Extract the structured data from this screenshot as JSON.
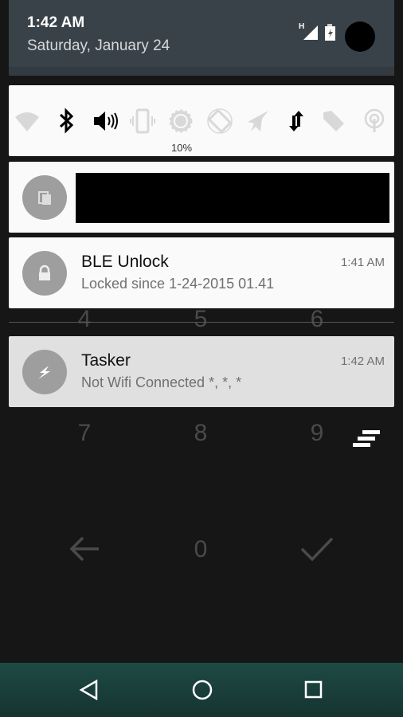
{
  "header": {
    "time": "1:42 AM",
    "date": "Saturday, January 24",
    "network_type": "H"
  },
  "quick_settings": {
    "items": [
      {
        "icon": "wifi-icon",
        "active": false
      },
      {
        "icon": "bluetooth-icon",
        "active": true
      },
      {
        "icon": "volume-icon",
        "active": true
      },
      {
        "icon": "vibrate-icon",
        "active": false
      },
      {
        "icon": "brightness-icon",
        "active": false
      },
      {
        "icon": "auto-rotate-icon",
        "active": false
      },
      {
        "icon": "airplane-icon",
        "active": false
      },
      {
        "icon": "mobile-data-icon",
        "active": true
      },
      {
        "icon": "nfc-tag-icon",
        "active": false
      },
      {
        "icon": "hotspot-icon",
        "active": false
      }
    ],
    "brightness_label": "10%"
  },
  "notifications": [
    {
      "app_icon": "clipboard-icon",
      "redacted": true
    },
    {
      "app_icon": "lock-icon",
      "title": "BLE Unlock",
      "text": "Locked since 1-24-2015 01.41",
      "time": "1:41 AM"
    },
    {
      "app_icon": "lightning-icon",
      "title": "Tasker",
      "text": "Not Wifi Connected *, *, *",
      "time": "1:42 AM"
    }
  ],
  "keypad": {
    "k4": "4",
    "k5": "5",
    "k6": "6",
    "k7": "7",
    "k8": "8",
    "k9": "9",
    "k0": "0"
  },
  "colors": {
    "header": "#3a4249",
    "card": "#fafafa",
    "tasker_card": "#e0e0e0",
    "nav": "#1e4a44"
  }
}
